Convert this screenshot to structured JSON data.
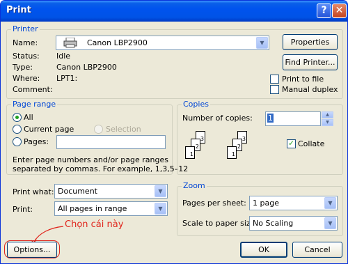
{
  "window": {
    "title": "Print",
    "help_label": "?",
    "close_label": "✕"
  },
  "printer": {
    "group_title": "Printer",
    "name_label": "Name:",
    "name_value": "Canon LBP2900",
    "properties_label": "Properties",
    "status_label": "Status:",
    "status_value": "Idle",
    "type_label": "Type:",
    "type_value": "Canon LBP2900",
    "where_label": "Where:",
    "where_value": "LPT1:",
    "comment_label": "Comment:",
    "find_printer_label": "Find Printer...",
    "print_to_file_label": "Print to file",
    "manual_duplex_label": "Manual duplex",
    "print_to_file_checked": false,
    "manual_duplex_checked": false
  },
  "page_range": {
    "group_title": "Page range",
    "all_label": "All",
    "current_page_label": "Current page",
    "selection_label": "Selection",
    "pages_label": "Pages:",
    "pages_value": "",
    "selected": "All",
    "help_line1": "Enter page numbers and/or page ranges",
    "help_line2": "separated by commas.  For example, 1,3,5–12"
  },
  "copies": {
    "group_title": "Copies",
    "number_label": "Number of copies:",
    "number_value": "1",
    "collate_label": "Collate",
    "collate_checked": true,
    "page_numbers": [
      "3",
      "2",
      "1",
      "3",
      "2",
      "1"
    ]
  },
  "print_what": {
    "label": "Print what:",
    "value": "Document"
  },
  "print": {
    "label": "Print:",
    "value": "All pages in range"
  },
  "zoom": {
    "group_title": "Zoom",
    "pages_per_sheet_label": "Pages per sheet:",
    "pages_per_sheet_value": "1 page",
    "scale_label": "Scale to paper size:",
    "scale_value": "No Scaling"
  },
  "footer": {
    "options_label": "Options...",
    "ok_label": "OK",
    "cancel_label": "Cancel"
  },
  "annotation": {
    "text": "Chọn cái này",
    "color": "#e0241b"
  }
}
